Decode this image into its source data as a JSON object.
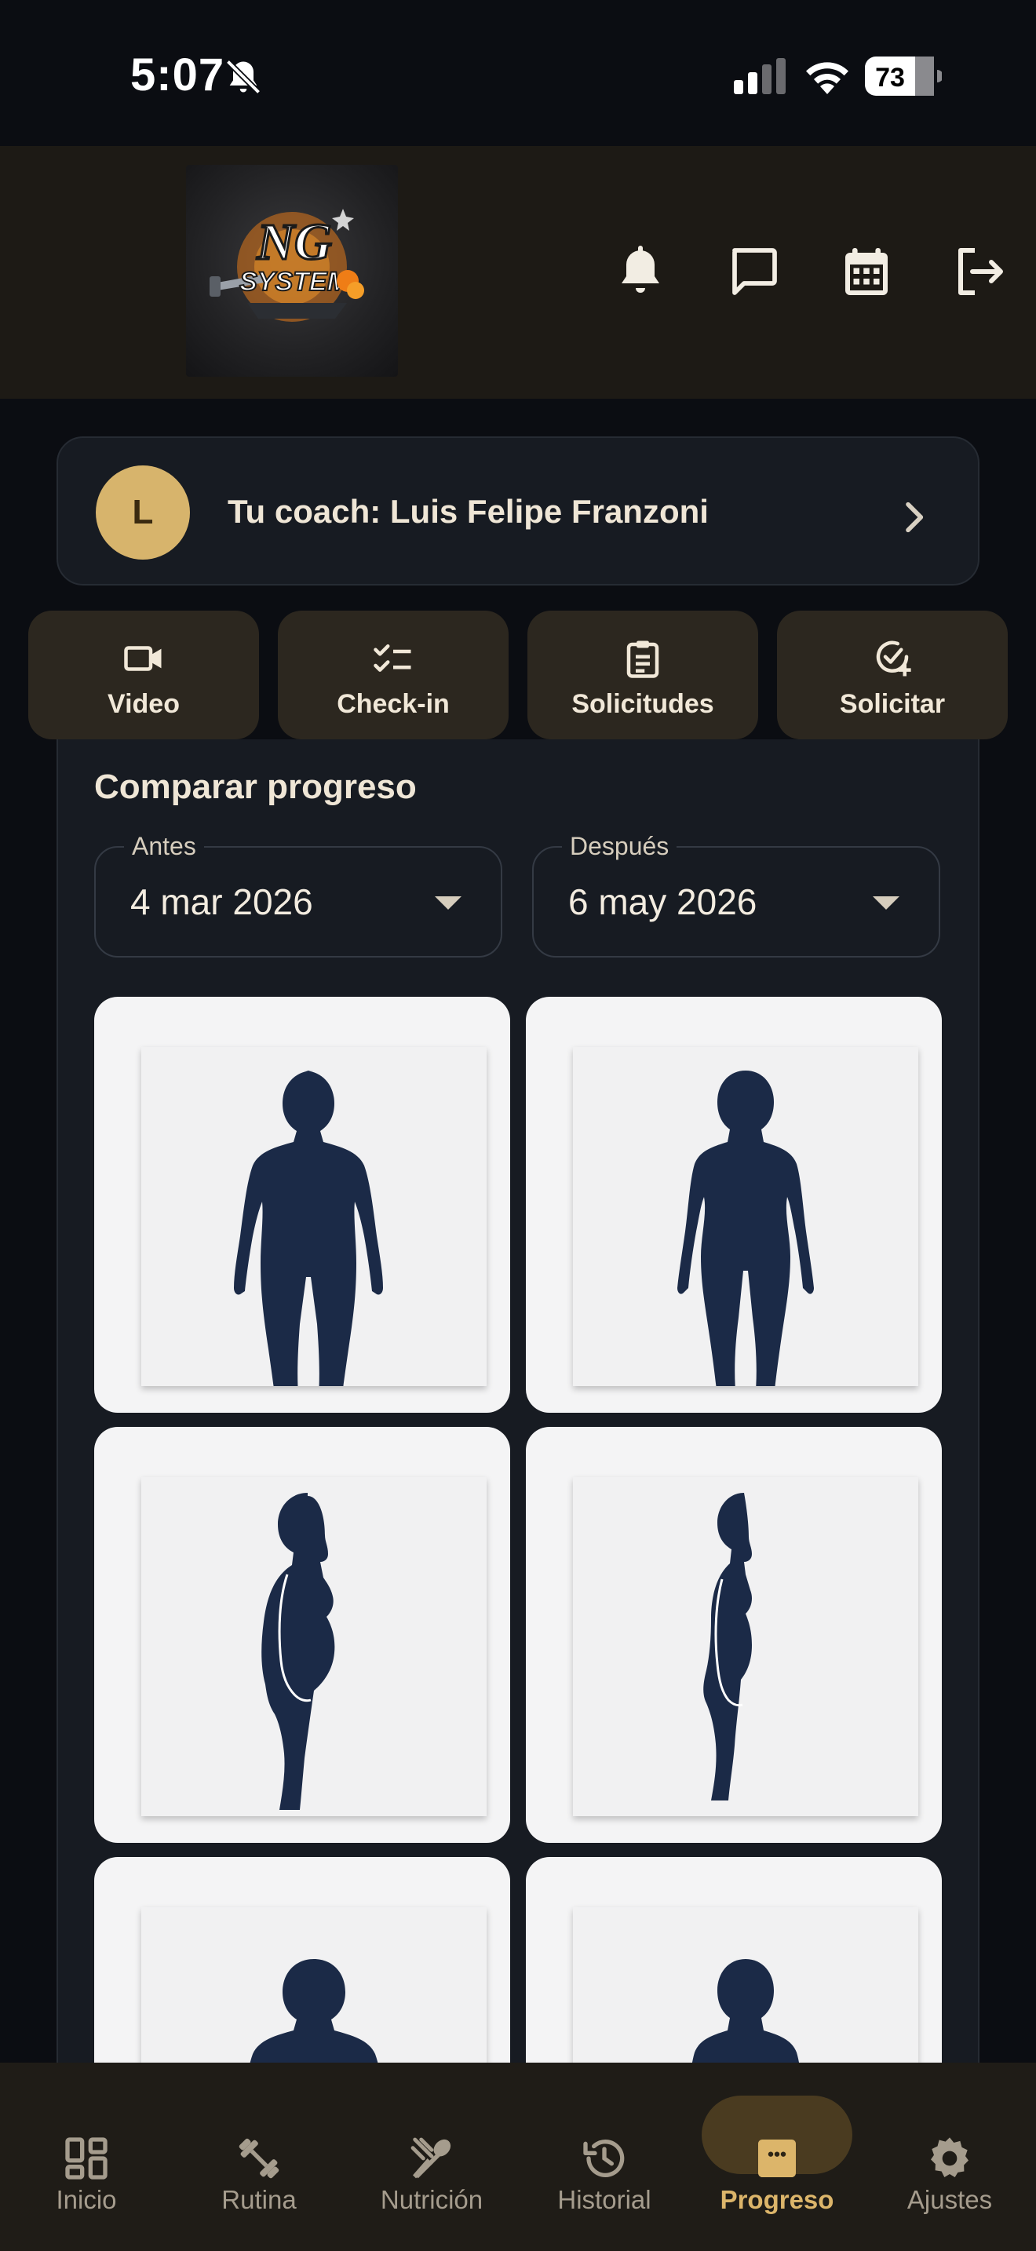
{
  "status_bar": {
    "time": "5:07",
    "battery": "73"
  },
  "header": {
    "logo_alt": "NG SYSTEM",
    "logo_text": "NG",
    "logo_subtext": "SYSTEM",
    "icons": [
      "notifications-icon",
      "chat-icon",
      "calendar-icon",
      "logout-icon"
    ]
  },
  "coach": {
    "initial": "L",
    "label": "Tu coach: Luis Felipe Franzoni"
  },
  "actions": [
    {
      "label": "Video",
      "icon": "video-icon"
    },
    {
      "label": "Check-in",
      "icon": "checklist-icon"
    },
    {
      "label": "Solicitudes",
      "icon": "clipboard-icon"
    },
    {
      "label": "Solicitar",
      "icon": "add-check-icon"
    }
  ],
  "compare": {
    "title": "Comparar progreso",
    "before": {
      "label": "Antes",
      "value": "4 mar 2026"
    },
    "after": {
      "label": "Después",
      "value": "6 may 2026"
    }
  },
  "bottom_nav": [
    {
      "label": "Inicio",
      "icon": "dashboard-icon",
      "active": false
    },
    {
      "label": "Rutina",
      "icon": "fitness-icon",
      "active": false
    },
    {
      "label": "Nutrición",
      "icon": "utensils-icon",
      "active": false
    },
    {
      "label": "Historial",
      "icon": "history-icon",
      "active": false
    },
    {
      "label": "Progreso",
      "icon": "progress-icon",
      "active": true
    },
    {
      "label": "Ajustes",
      "icon": "settings-icon",
      "active": false
    }
  ],
  "colors": {
    "accent": "#dcb56a",
    "avatar": "#d7b46c",
    "background": "#0b0d12",
    "card": "#171b22",
    "silhouette": "#1b2a47"
  }
}
